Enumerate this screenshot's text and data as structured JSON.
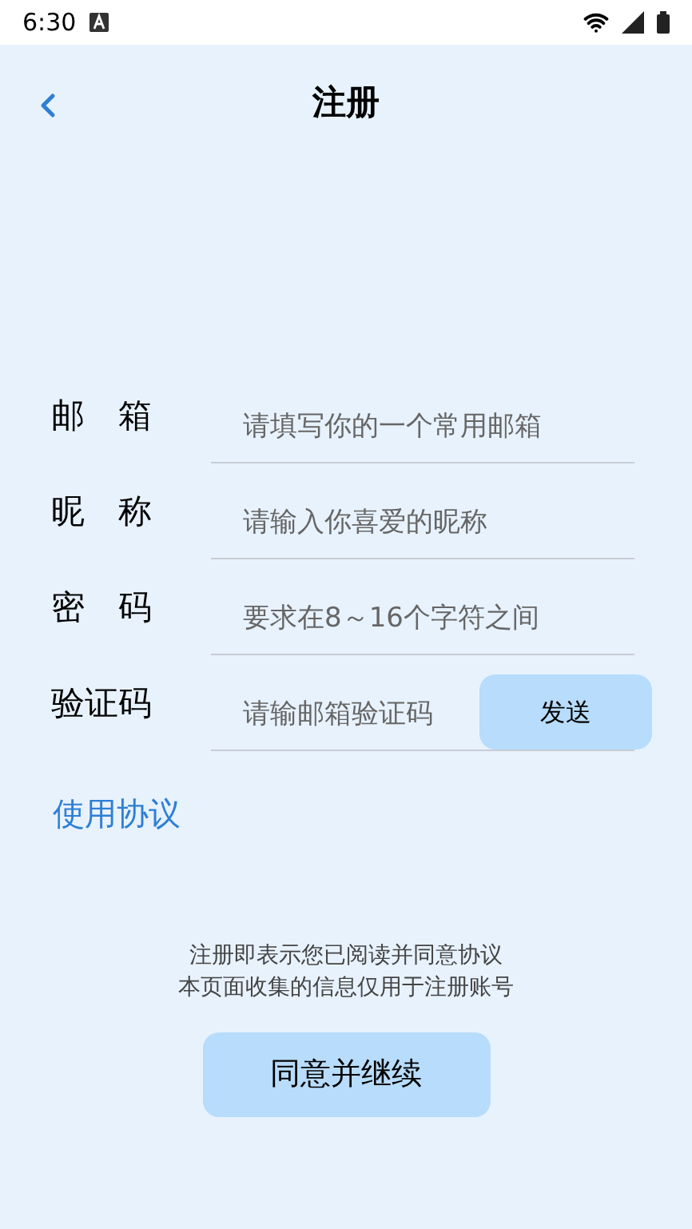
{
  "status_bar": {
    "time": "6:30"
  },
  "header": {
    "title": "注册"
  },
  "fields": [
    {
      "kind": "text",
      "label": "邮　箱",
      "placeholder": "请填写你的一个常用邮箱"
    },
    {
      "kind": "text",
      "label": "昵　称",
      "placeholder": "请输入你喜爱的昵称"
    },
    {
      "kind": "text",
      "label": "密　码",
      "placeholder": "要求在8～16个字符之间"
    },
    {
      "kind": "code",
      "label": "验证码",
      "placeholder": "请输邮箱验证码",
      "button": "发送"
    }
  ],
  "agreement_link": "使用协议",
  "notes": [
    "注册即表示您已阅读并同意协议",
    "本页面收集的信息仅用于注册账号"
  ],
  "continue_button": "同意并继续"
}
